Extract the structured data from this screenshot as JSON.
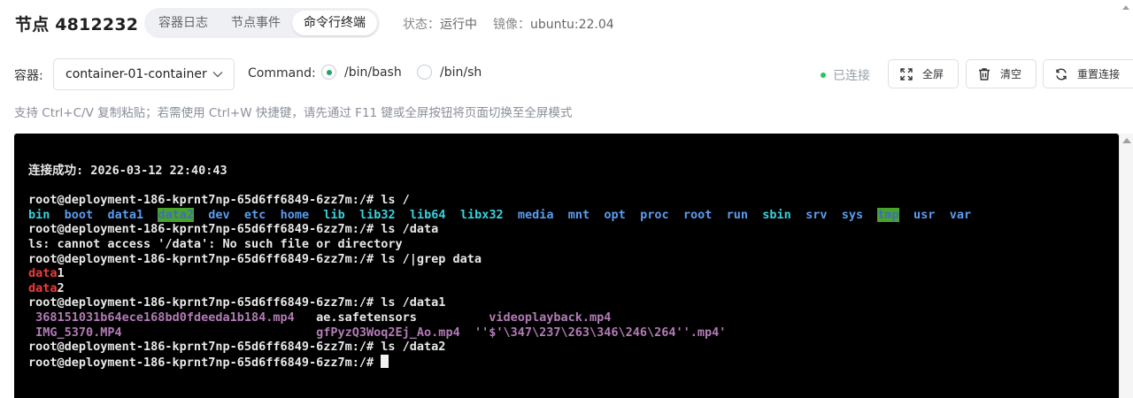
{
  "header": {
    "title": "节点 4812232",
    "tabs": [
      {
        "label": "容器日志",
        "active": false
      },
      {
        "label": "节点事件",
        "active": false
      },
      {
        "label": "命令行终端",
        "active": true
      }
    ],
    "status_label": "状态：",
    "status_value": "运行中",
    "image_label": "镜像：",
    "image_value": "ubuntu:22.04"
  },
  "toolbar": {
    "container_label": "容器:",
    "container_value": "container-01-container",
    "command_label": "Command:",
    "commands": [
      {
        "label": "/bin/bash",
        "selected": true
      },
      {
        "label": "/bin/sh",
        "selected": false
      }
    ],
    "connection_status": "已连接",
    "fullscreen_label": "全屏",
    "clear_label": "清空",
    "reconnect_label": "重置连接"
  },
  "hint": "支持 Ctrl+C/V 复制粘贴；若需使用 Ctrl+W 快捷键，请先通过 F11 键或全屏按钮将页面切换至全屏模式",
  "colors": {
    "accent_green": "#22a36b",
    "connected": "#22c55e",
    "terminal_bg": "#000000",
    "dir_blue": "#5b9cf0",
    "dir_cyan": "#3ad1dd",
    "grep_red": "#ee3b3b",
    "file_magenta": "#b27bb6"
  },
  "terminal": {
    "connect_line": "连接成功: 2026-03-12 22:40:43",
    "prompt": "root@deployment-186-kprnt7np-65d6ff6849-6zz7m:/#",
    "cmd1": " ls /",
    "ls_root": [
      {
        "name": "bin",
        "style": "cyan"
      },
      {
        "name": "boot",
        "style": "blue"
      },
      {
        "name": "data1",
        "style": "blue"
      },
      {
        "name": "data2",
        "style": "hlg"
      },
      {
        "name": "dev",
        "style": "blue"
      },
      {
        "name": "etc",
        "style": "blue"
      },
      {
        "name": "home",
        "style": "blue"
      },
      {
        "name": "lib",
        "style": "cyan"
      },
      {
        "name": "lib32",
        "style": "cyan"
      },
      {
        "name": "lib64",
        "style": "cyan"
      },
      {
        "name": "libx32",
        "style": "cyan"
      },
      {
        "name": "media",
        "style": "blue"
      },
      {
        "name": "mnt",
        "style": "blue"
      },
      {
        "name": "opt",
        "style": "blue"
      },
      {
        "name": "proc",
        "style": "blue"
      },
      {
        "name": "root",
        "style": "blue"
      },
      {
        "name": "run",
        "style": "blue"
      },
      {
        "name": "sbin",
        "style": "cyan"
      },
      {
        "name": "srv",
        "style": "blue"
      },
      {
        "name": "sys",
        "style": "blue"
      },
      {
        "name": "tmp",
        "style": "hlg"
      },
      {
        "name": "usr",
        "style": "blue"
      },
      {
        "name": "var",
        "style": "blue"
      }
    ],
    "cmd2": " ls /data",
    "err": "ls: cannot access '/data': No such file or directory",
    "cmd3": " ls /|grep data",
    "grep_match": "data",
    "grep1_rest": "1",
    "grep2_rest": "2",
    "cmd4": " ls /data1",
    "f1": "368151031b64ece168bd0fdeeda1b184.mp4",
    "f2": "ae.safetensors",
    "f3": "videoplayback.mp4",
    "f4": "IMG_5370.MP4",
    "f5": "gfPyzQ3Woq2Ej_Ao.mp4",
    "f6": "''$'\\347\\237\\263\\346\\246\\264''.mp4'",
    "cmd5": " ls /data2"
  }
}
